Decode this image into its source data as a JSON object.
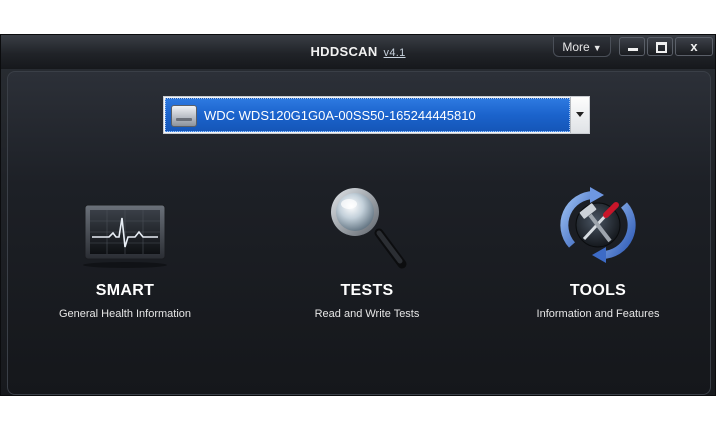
{
  "window": {
    "title": "HDDSCAN",
    "version": "v4.1",
    "more_label": "More",
    "close_glyph": "x"
  },
  "drive": {
    "selected": "WDC WDS120G1G0A-00SS50-165244445810"
  },
  "features": {
    "smart": {
      "label": "SMART",
      "description": "General Health Information",
      "icon": "heartbeat-monitor-icon"
    },
    "tests": {
      "label": "TESTS",
      "description": "Read and Write Tests",
      "icon": "magnifier-icon"
    },
    "tools": {
      "label": "TOOLS",
      "description": "Information and Features",
      "icon": "tools-refresh-icon"
    }
  },
  "colors": {
    "selection_blue": "#1b63cc",
    "background_dark": "#1d2026",
    "refresh_arrow_blue": "#4f7fd6",
    "heartbeat_line": "#e8eef5"
  }
}
